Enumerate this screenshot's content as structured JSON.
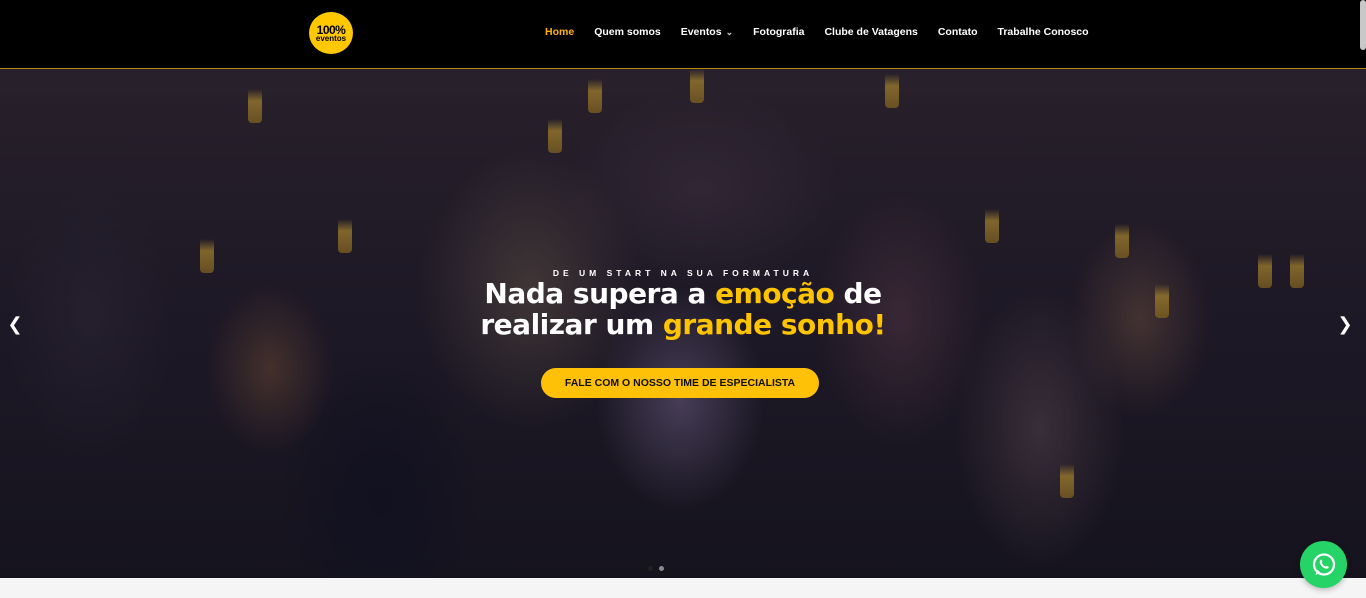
{
  "brand": {
    "logo_line1": "100%",
    "logo_line2": "eventos",
    "accent": "#ffc400"
  },
  "nav": {
    "items": [
      {
        "label": "Home",
        "active": true
      },
      {
        "label": "Quem somos"
      },
      {
        "label": "Eventos",
        "has_dropdown": true
      },
      {
        "label": "Fotografia"
      },
      {
        "label": "Clube de Vatagens"
      },
      {
        "label": "Contato"
      },
      {
        "label": "Trabalhe Conosco"
      }
    ]
  },
  "hero": {
    "kicker": "DE UM START NA SUA FORMATURA",
    "headline": {
      "part1": "Nada supera a ",
      "highlight1": "emoção",
      "part2": " de",
      "part3": "realizar um ",
      "highlight2": "grande sonho!"
    },
    "cta_label": "FALE COM O NOSSO TIME DE ESPECIALISTA",
    "prev_icon": "chevron-left-icon",
    "next_icon": "chevron-right-icon",
    "slides_count": 2,
    "active_slide": 1
  },
  "whatsapp": {
    "icon": "whatsapp-icon",
    "color": "#25d366"
  }
}
